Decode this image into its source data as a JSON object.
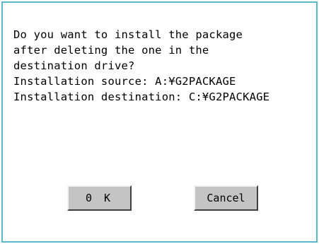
{
  "dialog": {
    "message_lines": [
      "Do you want to install the package",
      "after deleting the one in the",
      "destination drive?",
      "Installation source: A:¥G2PACKAGE",
      "Installation destination: C:¥G2PACKAGE"
    ],
    "ok_label": "0 K",
    "cancel_label": "Cancel"
  },
  "colors": {
    "border": "#5bb8c8",
    "button_face": "#c4c4c4",
    "background": "#ffffff"
  }
}
